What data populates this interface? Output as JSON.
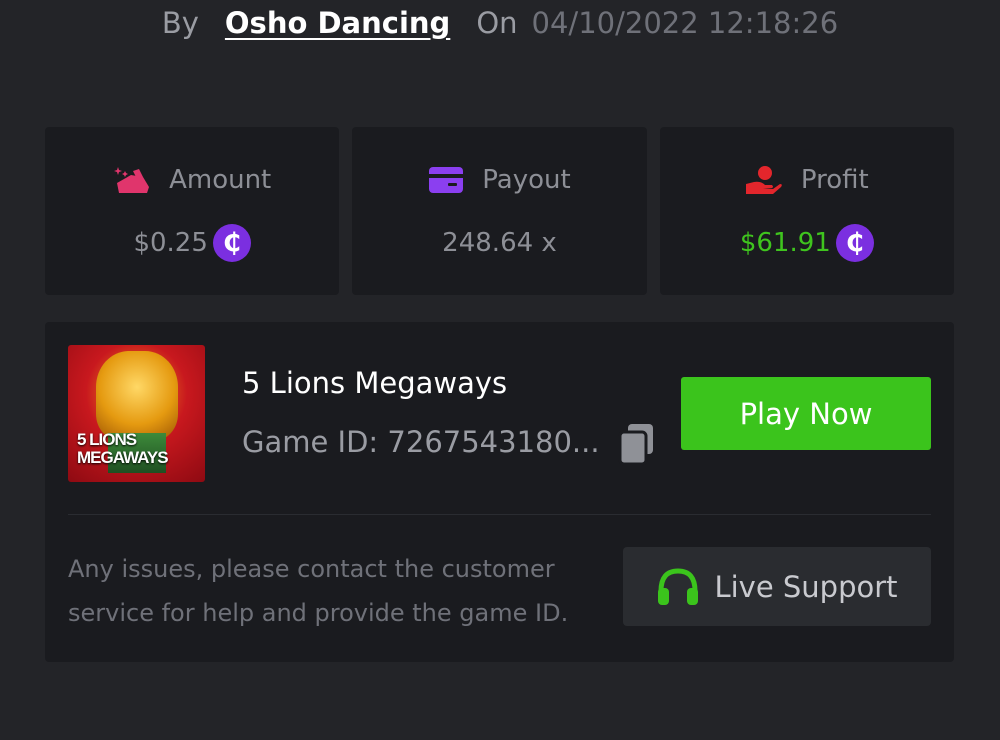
{
  "byline": {
    "by_label": "By",
    "author": "Osho Dancing",
    "on_label": "On",
    "datetime": "04/10/2022 12:18:26"
  },
  "stats": {
    "amount": {
      "label": "Amount",
      "value": "$0.25",
      "icon": "bet-amount-icon"
    },
    "payout": {
      "label": "Payout",
      "value": "248.64 x",
      "icon": "card-icon"
    },
    "profit": {
      "label": "Profit",
      "value": "$61.91",
      "icon": "hand-profit-icon"
    },
    "coin_symbol": "₵"
  },
  "game": {
    "thumbnail_text": "5 LIONS MEGAWAYS",
    "title": "5 Lions Megaways",
    "game_id": "Game ID: 7267543180...",
    "play_label": "Play Now"
  },
  "support": {
    "help_text": "Any issues, please contact the customer service for help and provide the game ID.",
    "button_label": "Live Support"
  },
  "colors": {
    "background": "#232428",
    "card": "#1a1b1f",
    "accent_green": "#3bc41c",
    "amount_pink": "#e0356c",
    "payout_purple": "#8b3ff0",
    "profit_red": "#e3262c",
    "coin_purple": "#7b2fe0"
  }
}
